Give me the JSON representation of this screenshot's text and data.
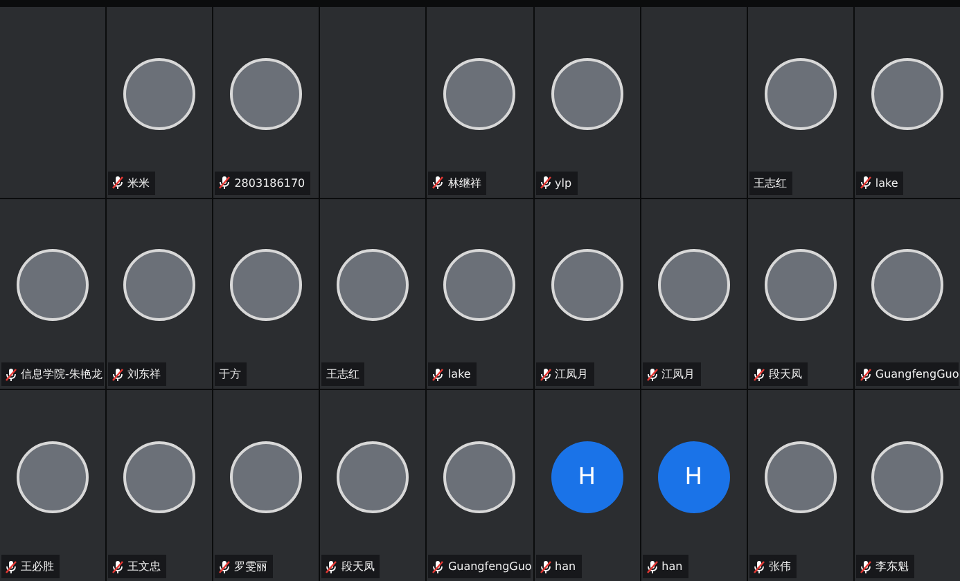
{
  "tiles": [
    {
      "kind": "empty"
    },
    {
      "name": "米米",
      "muted": true,
      "kind": "photo"
    },
    {
      "name": "2803186170",
      "muted": true,
      "kind": "photo"
    },
    {
      "kind": "empty"
    },
    {
      "name": "林继祥",
      "muted": true,
      "kind": "photo"
    },
    {
      "name": "ylp",
      "muted": true,
      "kind": "photo"
    },
    {
      "kind": "empty"
    },
    {
      "name": "王志红",
      "muted": false,
      "kind": "photo"
    },
    {
      "name": "lake",
      "muted": true,
      "kind": "photo"
    },
    {
      "name": "信息学院-朱艳龙",
      "muted": true,
      "kind": "photo"
    },
    {
      "name": "刘东祥",
      "muted": true,
      "kind": "photo"
    },
    {
      "name": "于方",
      "muted": false,
      "kind": "photo"
    },
    {
      "name": "王志红",
      "muted": false,
      "kind": "photo"
    },
    {
      "name": "lake",
      "muted": true,
      "kind": "photo"
    },
    {
      "name": "江凤月",
      "muted": true,
      "kind": "photo"
    },
    {
      "name": "江凤月",
      "muted": true,
      "kind": "photo"
    },
    {
      "name": "段天凤",
      "muted": true,
      "kind": "photo"
    },
    {
      "name": "GuangfengGuo",
      "muted": true,
      "kind": "photo"
    },
    {
      "name": "王必胜",
      "muted": true,
      "kind": "photo"
    },
    {
      "name": "王文忠",
      "muted": true,
      "kind": "photo"
    },
    {
      "name": "罗雯丽",
      "muted": true,
      "kind": "photo"
    },
    {
      "name": "段天凤",
      "muted": true,
      "kind": "photo"
    },
    {
      "name": "GuangfengGuo",
      "muted": true,
      "kind": "photo"
    },
    {
      "name": "han",
      "muted": true,
      "kind": "letter",
      "letter": "H"
    },
    {
      "name": "han",
      "muted": true,
      "kind": "letter",
      "letter": "H"
    },
    {
      "name": "张伟",
      "muted": true,
      "kind": "photo"
    },
    {
      "name": "李东魁",
      "muted": true,
      "kind": "photo"
    }
  ]
}
